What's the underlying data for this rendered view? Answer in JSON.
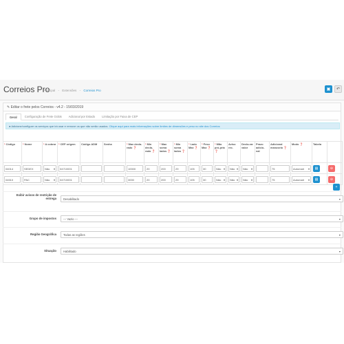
{
  "header": {
    "title": "Correios Pro",
    "breadcrumb": [
      "Principal",
      "Extensões",
      "Correios Pro"
    ]
  },
  "panel": {
    "title": "Editar o frete pelos Correios - v4.2 - 15/03/2019"
  },
  "tabs": [
    "Geral",
    "Configuração de Frete Grátis",
    "Adicional por Estado",
    "Limitação por Faixa de CEP"
  ],
  "info": {
    "text": "Adicione/configure os serviços que irá usar e remove os que não serão usados.",
    "link": "Clique aqui para mais informações sobre limites de dimensões e peso no site dos Correios"
  },
  "table": {
    "headers": [
      "Código",
      "Nome",
      "A cobrar",
      "CEP origem",
      "Código ADM",
      "Senha",
      "Max decla-rado",
      "Min decla-rado",
      "Max soma lados",
      "Min soma lados",
      "Lado Max",
      "Peso Max",
      "Mão pró-pria",
      "Aviso rec.",
      "Decla-rar valor",
      "Prazo adicio-nal",
      "Adicional manuseio",
      "Modo",
      "Tabela"
    ],
    "required": [
      true,
      true,
      true,
      true,
      false,
      false,
      true,
      true,
      true,
      true,
      true,
      true,
      true,
      false,
      false,
      false,
      false,
      false,
      false
    ],
    "rows": [
      {
        "codigo": "04014",
        "nome": "SEDEX",
        "cobrar": "Não",
        "cep": "04710001",
        "adm": "",
        "senha": "",
        "maxdec": "10000",
        "mindec": "20",
        "maxsoma": "200",
        "minsoma": "29",
        "ladomax": "105",
        "pesomax": "30",
        "mao": "Não",
        "aviso": "Não",
        "decl": "Não",
        "prazo": "",
        "adicional": "75",
        "modo": "Automati"
      },
      {
        "codigo": "04510",
        "nome": "PAC",
        "cobrar": "Não",
        "cep": "04710001",
        "adm": "",
        "senha": "",
        "maxdec": "3000",
        "mindec": "20",
        "maxsoma": "200",
        "minsoma": "29",
        "ladomax": "105",
        "pesomax": "30",
        "mao": "Não",
        "aviso": "Não",
        "decl": "Não",
        "prazo": "",
        "adicional": "75",
        "modo": "Automati"
      }
    ]
  },
  "fields": [
    {
      "label": "Exibir avisos de restrição de entrega",
      "value": "Desabilitado"
    },
    {
      "label": "Grupo de impostos",
      "value": "--- Vazio ---"
    },
    {
      "label": "Região Geográfica",
      "value": "Todas as regiões"
    },
    {
      "label": "Situação",
      "value": "Habilitado"
    }
  ]
}
